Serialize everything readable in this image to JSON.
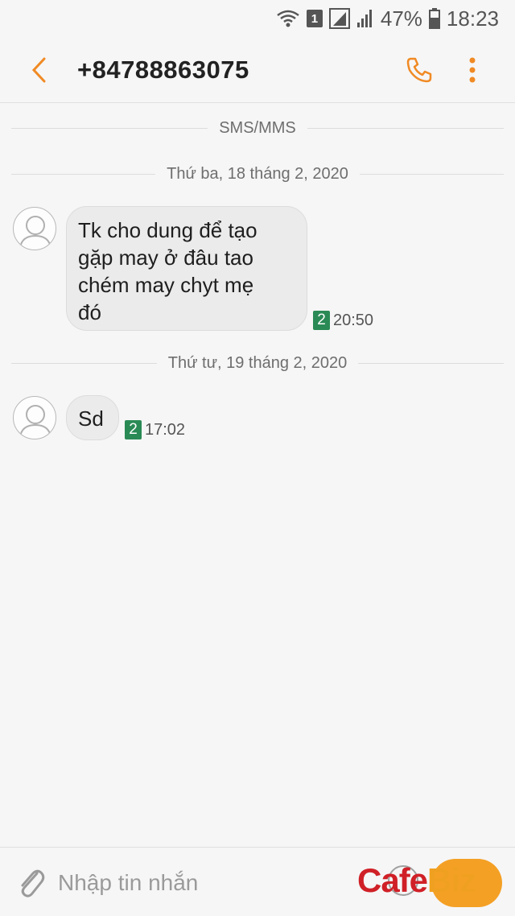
{
  "status": {
    "battery_percent": "47%",
    "time": "18:23",
    "sim_slot": "1"
  },
  "header": {
    "title": "+84788863075"
  },
  "channel_label": "SMS/MMS",
  "conversation": [
    {
      "date": "Thứ ba, 18 tháng 2, 2020",
      "message": {
        "lines": [
          "Tk cho dung để tạo",
          "gặp may ở đâu tao",
          "chém may chyt mẹ",
          "đó"
        ],
        "sim": "2",
        "time": "20:50"
      }
    },
    {
      "date": "Thứ tư, 19 tháng 2, 2020",
      "message": {
        "lines": [
          "Sd"
        ],
        "sim": "2",
        "time": "17:02"
      }
    }
  ],
  "composer": {
    "placeholder": "Nhập tin nhắn"
  },
  "watermark": {
    "cafe": "Cafe",
    "biz": "Biz"
  },
  "colors": {
    "accent": "#f08a24",
    "sim_badge": "#2a8a55",
    "bubble": "#ebebeb"
  }
}
